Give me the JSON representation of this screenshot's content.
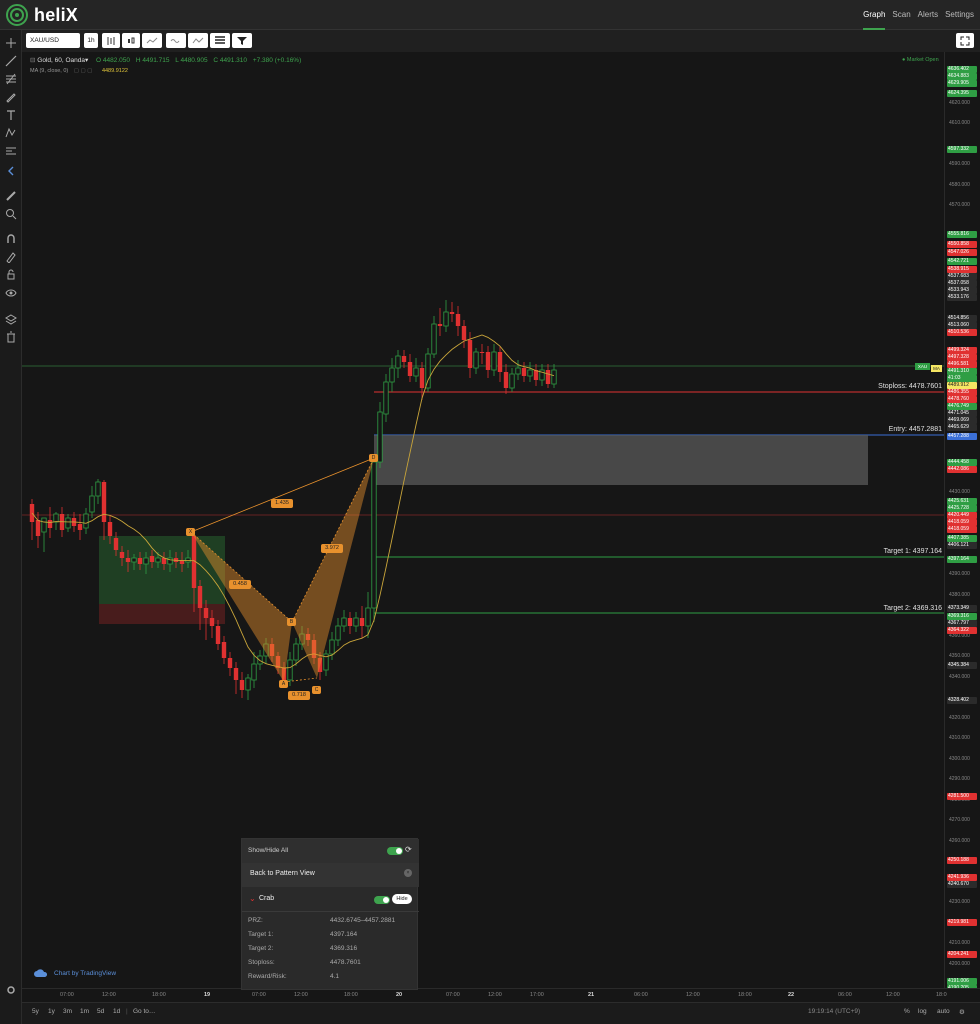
{
  "app": {
    "name": "heliX"
  },
  "nav": [
    {
      "label": "Graph",
      "active": true
    },
    {
      "label": "Scan",
      "active": false
    },
    {
      "label": "Alerts",
      "active": false
    },
    {
      "label": "Settings",
      "active": false
    }
  ],
  "toolbar": {
    "symbol": "XAU/USD",
    "interval": "1h"
  },
  "legend": {
    "title": "Gold, 60, Oanda",
    "open": "O 4482.050",
    "high": "H 4491.715",
    "low": "L 4480.905",
    "close": "C 4491.310",
    "change": "+7.380 (+0.16%)",
    "ma_label": "MA (9, close, 0)",
    "ma_value": "4489.9122",
    "market_status": "Market Open"
  },
  "levels": {
    "stoploss": "Stoploss: 4478.7601",
    "entry": "Entry: 4457.2881",
    "target1": "Target 1: 4397.164",
    "target2": "Target 2: 4369.316"
  },
  "pattern_labels": {
    "x": "X",
    "a": "A",
    "b": "B",
    "c": "C",
    "d": "D",
    "r_xb": "0.458",
    "r_ac": "0.718",
    "r_bd": "3.972",
    "r_xd": "1.435"
  },
  "price_axis": {
    "ticks": [
      "4620.000",
      "4610.000",
      "4590.000",
      "4580.000",
      "4570.000",
      "4530.000",
      "4430.000",
      "4390.000",
      "4380.000",
      "4360.000",
      "4350.000",
      "4340.000",
      "4320.000",
      "4310.000",
      "4300.000",
      "4290.000",
      "4280.000",
      "4270.000",
      "4260.000",
      "4230.000",
      "4220.000",
      "4210.000",
      "4200.000"
    ],
    "badges": [
      {
        "v": "4636.402",
        "c": "#2f9e44"
      },
      {
        "v": "4634.883",
        "c": "#2f9e44"
      },
      {
        "v": "4629.905",
        "c": "#2f9e44"
      },
      {
        "v": "4624.395",
        "c": "#2f9e44"
      },
      {
        "v": "4597.332",
        "c": "#2f9e44"
      },
      {
        "v": "4555.816",
        "c": "#2f9e44"
      },
      {
        "v": "4550.858",
        "c": "#e03131"
      },
      {
        "v": "4547.026",
        "c": "#e03131"
      },
      {
        "v": "4542.721",
        "c": "#2f9e44"
      },
      {
        "v": "4538.915",
        "c": "#e03131"
      },
      {
        "v": "4537.683",
        "c": "#2b2b2b"
      },
      {
        "v": "4537.058",
        "c": "#2b2b2b"
      },
      {
        "v": "4533.943",
        "c": "#2b2b2b"
      },
      {
        "v": "4533.176",
        "c": "#2b2b2b"
      },
      {
        "v": "4514.856",
        "c": "#2b2b2b"
      },
      {
        "v": "4513.060",
        "c": "#2b2b2b"
      },
      {
        "v": "4510.536",
        "c": "#e03131"
      },
      {
        "v": "4499.324",
        "c": "#e03131"
      },
      {
        "v": "4497.328",
        "c": "#e03131"
      },
      {
        "v": "4496.581",
        "c": "#e03131"
      },
      {
        "v": "4491.310",
        "c": "#2f9e44"
      },
      {
        "v": "41:03",
        "c": "#2f9e44"
      },
      {
        "v": "4489.912",
        "c": "#f5e663"
      },
      {
        "v": "4486.355",
        "c": "#e03131"
      },
      {
        "v": "4478.760",
        "c": "#e03131"
      },
      {
        "v": "4476.749",
        "c": "#2f9e44"
      },
      {
        "v": "4471.045",
        "c": "#2b2b2b"
      },
      {
        "v": "4469.069",
        "c": "#2b2b2b"
      },
      {
        "v": "4465.629",
        "c": "#2b2b2b"
      },
      {
        "v": "4457.288",
        "c": "#3b6fd6"
      },
      {
        "v": "4444.458",
        "c": "#2f9e44"
      },
      {
        "v": "4442.086",
        "c": "#e03131"
      },
      {
        "v": "4425.631",
        "c": "#2f9e44"
      },
      {
        "v": "4425.728",
        "c": "#2f9e44"
      },
      {
        "v": "4420.449",
        "c": "#e03131"
      },
      {
        "v": "4418.059",
        "c": "#e03131"
      },
      {
        "v": "4418.059",
        "c": "#e03131"
      },
      {
        "v": "4407.385",
        "c": "#2f9e44"
      },
      {
        "v": "4406.121",
        "c": "#2b2b2b"
      },
      {
        "v": "4397.164",
        "c": "#2f9e44"
      },
      {
        "v": "4373.349",
        "c": "#2b2b2b"
      },
      {
        "v": "4369.316",
        "c": "#2f9e44"
      },
      {
        "v": "4367.797",
        "c": "#2b2b2b"
      },
      {
        "v": "4364.322",
        "c": "#e03131"
      },
      {
        "v": "4345.384",
        "c": "#2b2b2b"
      },
      {
        "v": "4328.402",
        "c": "#2b2b2b"
      },
      {
        "v": "4281.500",
        "c": "#e03131"
      },
      {
        "v": "4250.188",
        "c": "#e03131"
      },
      {
        "v": "4241.936",
        "c": "#e03131"
      },
      {
        "v": "4240.670",
        "c": "#2b2b2b"
      },
      {
        "v": "4219.981",
        "c": "#e03131"
      },
      {
        "v": "4204.241",
        "c": "#e03131"
      },
      {
        "v": "4191.006",
        "c": "#2f9e44"
      },
      {
        "v": "4190.205",
        "c": "#2f9e44"
      }
    ]
  },
  "time_axis": [
    "07:00",
    "12:00",
    "18:00",
    "19",
    "07:00",
    "12:00",
    "18:00",
    "20",
    "07:00",
    "12:00",
    "17:00",
    "21",
    "06:00",
    "12:00",
    "18:00",
    "22",
    "06:00",
    "12:00",
    "18:0"
  ],
  "bottom": {
    "ranges": [
      "5y",
      "1y",
      "3m",
      "1m",
      "5d",
      "1d"
    ],
    "goto": "Go to…",
    "clock": "19:19:14 (UTC+9)",
    "pct": "%",
    "log": "log",
    "auto": "auto"
  },
  "panel": {
    "show_hide_all": "Show/Hide All",
    "back": "Back to Pattern View",
    "pattern_name": "Crab",
    "hide_label": "Hide",
    "rows": [
      {
        "k": "PRZ:",
        "v": "4432.6745–4457.2881"
      },
      {
        "k": "Target 1:",
        "v": "4397.164"
      },
      {
        "k": "Target 2:",
        "v": "4369.316"
      },
      {
        "k": "Stoploss:",
        "v": "4478.7601"
      },
      {
        "k": "Reward/Risk:",
        "v": "4.1"
      }
    ]
  },
  "credit": "Chart by TradingView",
  "xau_tag": "XAU",
  "ma_tag": "MA",
  "colors": {
    "bull": "#2f9e44",
    "bear": "#e03131",
    "pattern": "#e8912d",
    "accent": "#3ea34e"
  }
}
